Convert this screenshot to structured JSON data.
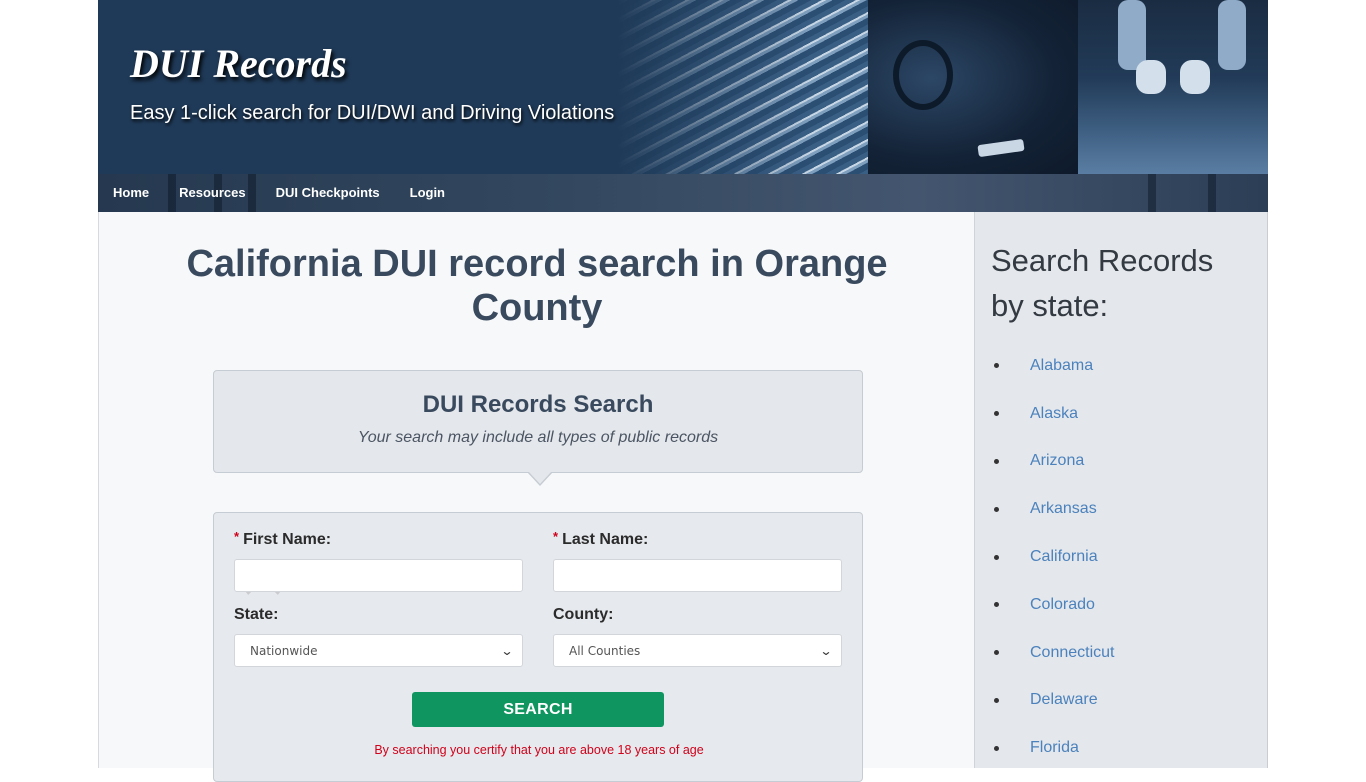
{
  "header": {
    "site_title": "DUI Records",
    "tagline": "Easy 1-click search for DUI/DWI and Driving Violations"
  },
  "nav": {
    "items": [
      {
        "label": "Home"
      },
      {
        "label": "Resources"
      },
      {
        "label": "DUI Checkpoints"
      },
      {
        "label": "Login"
      }
    ]
  },
  "main": {
    "page_title": "California DUI record search in Orange County",
    "search_box": {
      "title": "DUI Records Search",
      "subtitle": "Your search may include all types of public records"
    },
    "form": {
      "required_marker": "*",
      "first_name": {
        "label": "First Name:",
        "value": "",
        "placeholder": ""
      },
      "last_name": {
        "label": "Last Name:",
        "value": "",
        "placeholder": ""
      },
      "state": {
        "label": "State:",
        "selected": "Nationwide"
      },
      "county": {
        "label": "County:",
        "selected": "All Counties"
      },
      "search_button": "SEARCH",
      "disclaimer": "By searching you certify that you are above 18 years of age"
    }
  },
  "sidebar": {
    "title": "Search Records by state:",
    "states": [
      "Alabama",
      "Alaska",
      "Arizona",
      "Arkansas",
      "California",
      "Colorado",
      "Connecticut",
      "Delaware",
      "Florida"
    ]
  },
  "colors": {
    "header_bg": "#1f3a58",
    "title_text": "#3a4a5e",
    "search_button": "#0f9660",
    "required": "#d0021b",
    "link": "#4b82bd"
  },
  "icons": {
    "select_arrow": "chevron-down-icon",
    "loading": "spinner-icon",
    "list_bullet": "bullet-icon"
  }
}
